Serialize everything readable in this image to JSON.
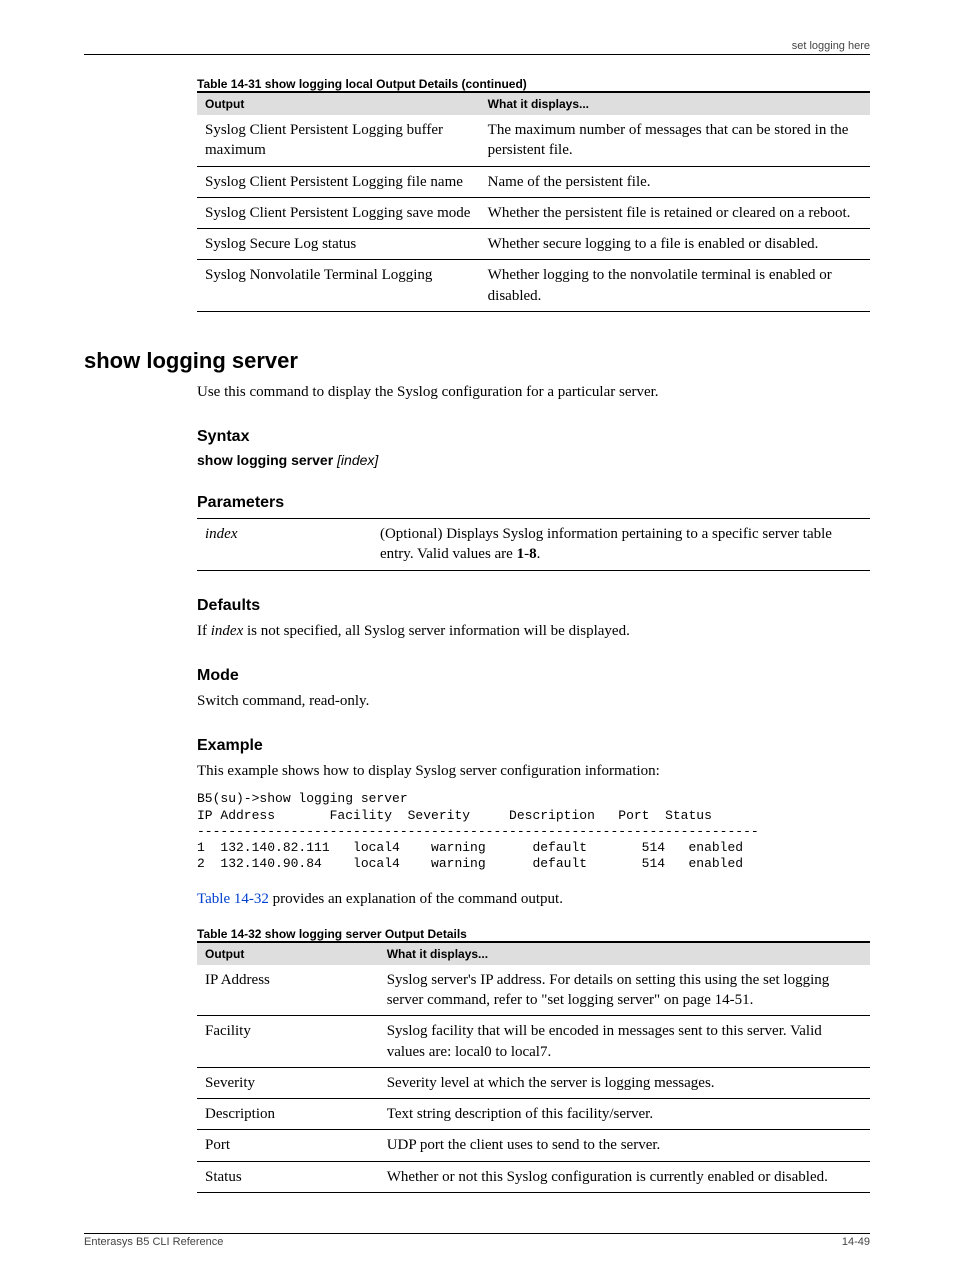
{
  "runhead": "set logging here",
  "table31": {
    "caption": "Table 14-31 show logging local Output Details (continued)",
    "header_col1": "Output",
    "header_col2": "What it displays...",
    "rows": [
      {
        "c1": "Syslog Client Persistent Logging buffer maximum",
        "c2": "The maximum number of messages that can be stored in the persistent file."
      },
      {
        "c1": "Syslog Client Persistent Logging file name",
        "c2": "Name of the persistent file."
      },
      {
        "c1": "Syslog Client Persistent Logging save mode",
        "c2": "Whether the persistent file is retained or cleared on a reboot."
      },
      {
        "c1": "Syslog Secure Log status",
        "c2": "Whether secure logging to a file is enabled or disabled."
      },
      {
        "c1": "Syslog Nonvolatile Terminal Logging",
        "c2": "Whether logging to the nonvolatile terminal is enabled or disabled."
      }
    ]
  },
  "cmdname": "show logging server",
  "desc": "Use this command to display the Syslog configuration for a particular server.",
  "syntax_label": "Syntax",
  "syntax_cmd": "show logging server ",
  "syntax_opt": "[index]",
  "params_label": "Parameters",
  "param_name": "index",
  "param_desc_a": "(Optional) Displays Syslog information pertaining to a specific server table entry. Valid values are ",
  "param_desc_b": "1",
  "param_desc_c": "-",
  "param_desc_d": "8",
  "param_desc_e": ".",
  "defaults_label": "Defaults",
  "defaults_a": "If ",
  "defaults_b": "index",
  "defaults_c": " is not specified, all Syslog server information will be displayed.",
  "mode_label": "Mode",
  "mode_text": "Switch command, read-only.",
  "example_label": "Example",
  "example_intro": "This example shows how to display Syslog server configuration information:",
  "code": "B5(su)->show logging server\nIP Address       Facility  Severity     Description   Port  Status\n------------------------------------------------------------------------\n1  132.140.82.111   local4    warning      default       514   enabled\n2  132.140.90.84    local4    warning      default       514   enabled",
  "table_ref_a": "Table 14-32",
  "table_ref_b": " provides an explanation of the command output.",
  "table32": {
    "caption": "Table 14-32 show logging server Output Details",
    "header_col1": "Output",
    "header_col2": "What it displays...",
    "rows": [
      {
        "c1": "IP Address",
        "c2": "Syslog server's IP address. For details on setting this using the set logging server command, refer to \"set logging server\" on page 14-51."
      },
      {
        "c1": "Facility",
        "c2": "Syslog facility that will be encoded in messages sent to this server. Valid values are: local0 to local7."
      },
      {
        "c1": "Severity",
        "c2": "Severity level at which the server is logging messages."
      },
      {
        "c1": "Description",
        "c2": "Text string description of this facility/server."
      },
      {
        "c1": "Port",
        "c2": "UDP port the client uses to send to the server."
      },
      {
        "c1": "Status",
        "c2": "Whether or not this Syslog configuration is currently enabled or disabled."
      }
    ]
  },
  "footer_left": "Enterasys B5 CLI Reference",
  "footer_right": "14-49"
}
